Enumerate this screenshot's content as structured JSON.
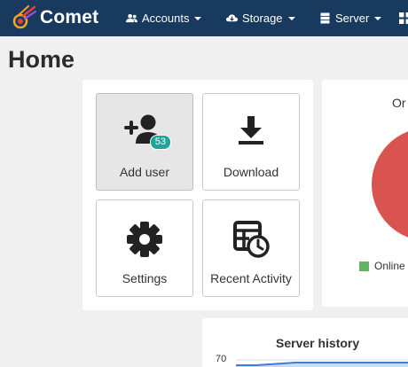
{
  "brand": {
    "name": "Comet"
  },
  "nav": {
    "accounts": "Accounts",
    "storage": "Storage",
    "server": "Server"
  },
  "page": {
    "title": "Home"
  },
  "tiles": {
    "add_user": {
      "label": "Add user",
      "badge": "53"
    },
    "download": {
      "label": "Download"
    },
    "settings": {
      "label": "Settings"
    },
    "recent_activity": {
      "label": "Recent Activity"
    }
  },
  "status_card": {
    "title": "Or",
    "legend_online": "Online",
    "colors": {
      "online": "#5cb85c",
      "offline": "#d9534f"
    }
  },
  "chart_data": {
    "type": "line",
    "title": "Server history",
    "visible_y_ticks": [
      "70"
    ],
    "series": [
      {
        "values": [
          68,
          68,
          68.5,
          69,
          69,
          69,
          69,
          69,
          69,
          69
        ]
      }
    ]
  },
  "colors": {
    "navbar": "#173a5e",
    "accent": "#21a39a",
    "line": "#3b7dd8"
  }
}
